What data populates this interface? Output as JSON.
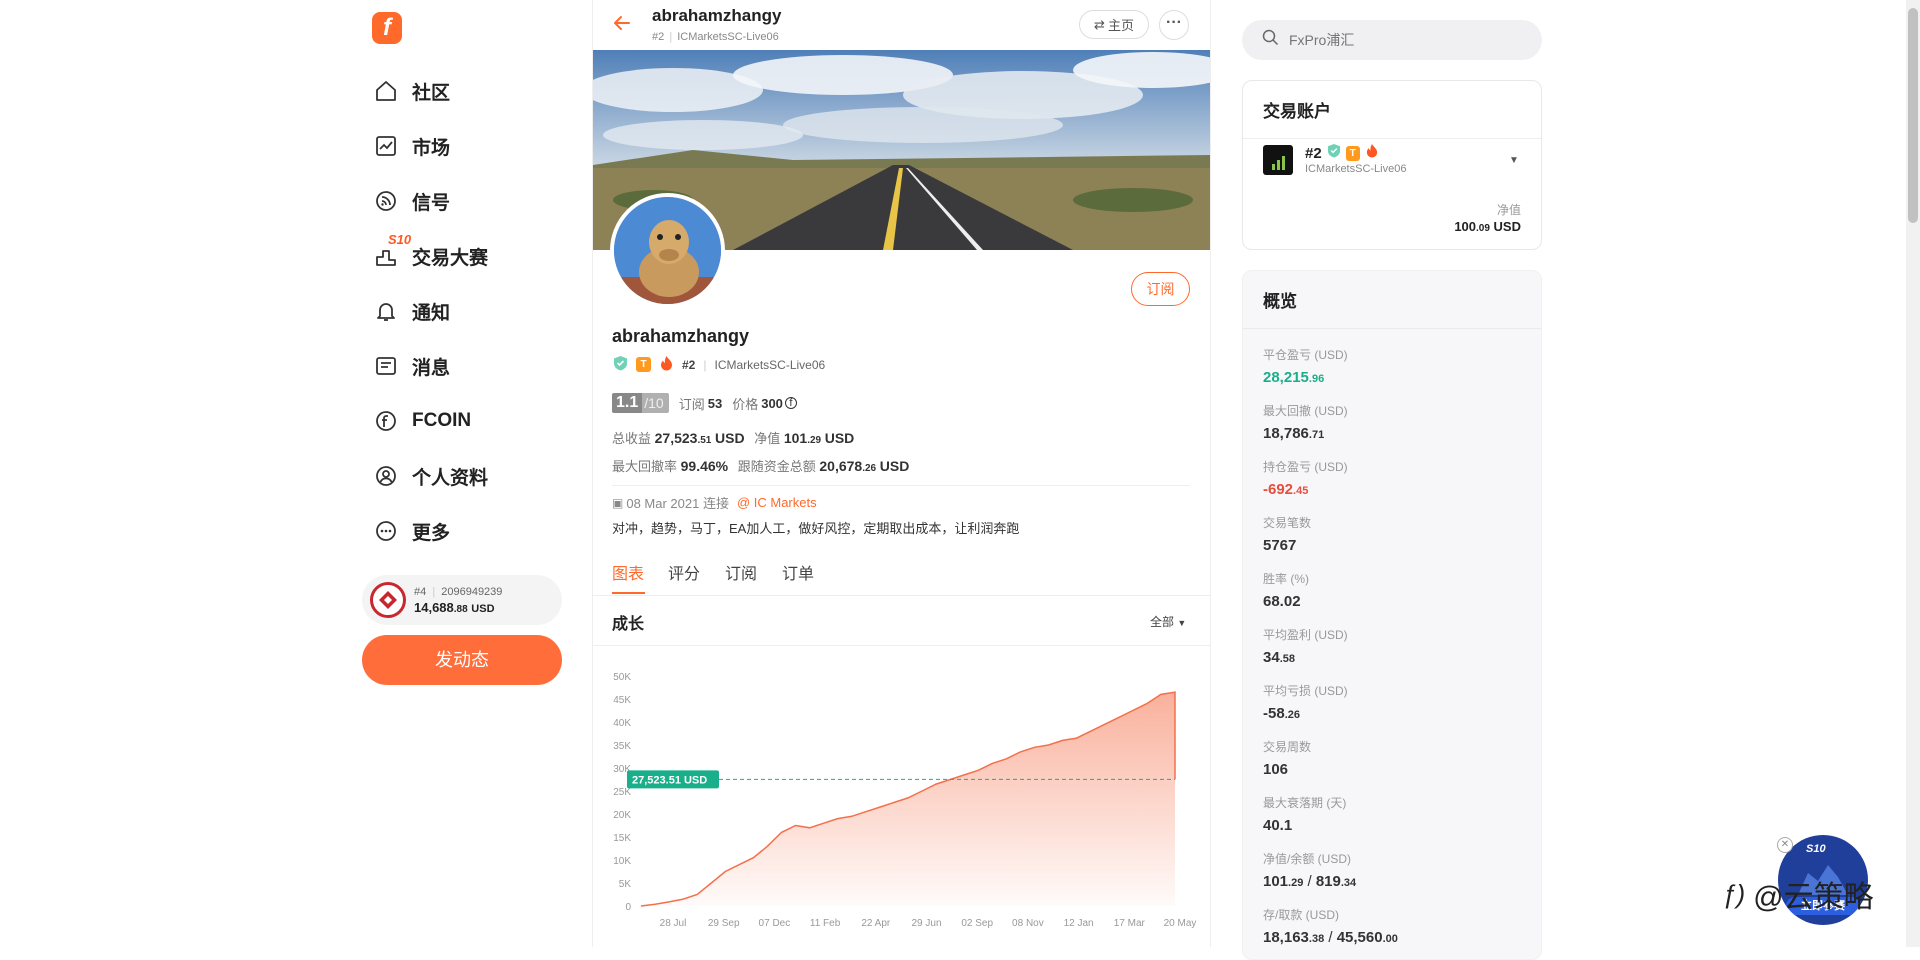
{
  "colors": {
    "accent": "#ff6a2b",
    "green": "#1aaf8b",
    "red": "#e84c3d",
    "chart_line": "#f4704a"
  },
  "sidebar": {
    "items": [
      {
        "label": "社区",
        "icon": "home-icon"
      },
      {
        "label": "市场",
        "icon": "chart-icon"
      },
      {
        "label": "信号",
        "icon": "rss-icon"
      },
      {
        "label": "交易大赛",
        "icon": "podium-icon",
        "badge": "S10"
      },
      {
        "label": "通知",
        "icon": "bell-icon"
      },
      {
        "label": "消息",
        "icon": "message-icon"
      },
      {
        "label": "FCOIN",
        "icon": "coin-icon"
      },
      {
        "label": "个人资料",
        "icon": "user-icon"
      },
      {
        "label": "更多",
        "icon": "more-icon"
      }
    ],
    "account": {
      "rank": "#4",
      "id": "2096949239",
      "balance_main": "14,688",
      "balance_dec": ".88",
      "currency": "USD"
    },
    "post_button": "发动态"
  },
  "header": {
    "name": "abrahamzhangy",
    "rank": "#2",
    "server": "ICMarketsSC-Live06",
    "home_button": "主页"
  },
  "profile": {
    "name": "abrahamzhangy",
    "rank": "#2",
    "server": "ICMarketsSC-Live06",
    "subscribe_button": "订阅",
    "score": "1.1",
    "score_max": "/10",
    "subs_label": "订阅",
    "subs_value": "53",
    "price_label": "价格",
    "price_value": "300",
    "total_label": "总收益",
    "total_main": "27,523",
    "total_dec": ".51",
    "total_unit": "USD",
    "equity_label": "净值",
    "equity_main": "101",
    "equity_dec": ".29",
    "equity_unit": "USD",
    "dd_label": "最大回撤率",
    "dd_value": "99.46%",
    "follow_label": "跟随资金总额",
    "follow_main": "20,678",
    "follow_dec": ".26",
    "follow_unit": "USD",
    "connected": "08 Mar 2021 连接",
    "broker": "IC Markets",
    "bio": "对冲，趋势，马丁，EA加人工，做好风控，定期取出成本，让利润奔跑"
  },
  "tabs": [
    "图表",
    "评分",
    "订阅",
    "订单"
  ],
  "growth": {
    "title": "成长",
    "filter": "全部",
    "current_label": "27,523.51 USD"
  },
  "chart_data": {
    "type": "area",
    "title": "成长",
    "x_ticks": [
      "28 Jul",
      "29 Sep",
      "07 Dec",
      "11 Feb",
      "22 Apr",
      "29 Jun",
      "02 Sep",
      "08 Nov",
      "12 Jan",
      "17 Mar",
      "20 May"
    ],
    "y_ticks": [
      "0",
      "5K",
      "10K",
      "15K",
      "20K",
      "25K",
      "30K",
      "35K",
      "40K",
      "45K",
      "50K"
    ],
    "ylim": [
      0,
      50000
    ],
    "reference_line": 27523.51,
    "series": [
      {
        "values": [
          0,
          400,
          900,
          1500,
          2500,
          5000,
          7500,
          9000,
          10500,
          13000,
          16000,
          17500,
          17000,
          18000,
          19000,
          19500,
          20500,
          21500,
          22500,
          23500,
          25000,
          26500,
          27500,
          28500,
          29500,
          31000,
          32000,
          33500,
          34500,
          35000,
          36000,
          36500,
          38000,
          39500,
          41000,
          42500,
          44000,
          46000,
          46500,
          27523
        ]
      }
    ]
  },
  "search": {
    "placeholder": "FxPro浦汇"
  },
  "trade_account": {
    "title": "交易账户",
    "rank": "#2",
    "server": "ICMarketsSC-Live06",
    "equity_label": "净值",
    "equity_main": "100",
    "equity_dec": ".09",
    "equity_unit": "USD"
  },
  "overview": {
    "title": "概览",
    "stats": [
      {
        "label": "平仓盈亏 (USD)",
        "main": "28,215",
        "dec": ".96",
        "color": "#1aaf8b"
      },
      {
        "label": "最大回撤 (USD)",
        "main": "18,786",
        "dec": ".71",
        "color": "#333333"
      },
      {
        "label": "持仓盈亏 (USD)",
        "main": "-692",
        "dec": ".45",
        "color": "#e84c3d"
      },
      {
        "label": "交易笔数",
        "main": "5767",
        "dec": "",
        "color": "#333333"
      },
      {
        "label": "胜率 (%)",
        "main": "68.02",
        "dec": "",
        "color": "#333333"
      },
      {
        "label": "平均盈利 (USD)",
        "main": "34",
        "dec": ".58",
        "color": "#333333"
      },
      {
        "label": "平均亏损 (USD)",
        "main": "-58",
        "dec": ".26",
        "color": "#333333"
      },
      {
        "label": "交易周数",
        "main": "106",
        "dec": "",
        "color": "#333333"
      },
      {
        "label": "最大衰落期 (天)",
        "main": "40.1",
        "dec": "",
        "color": "#333333"
      },
      {
        "label": "净值/余额 (USD)",
        "main": "101",
        "dec": ".29",
        "sep": " / ",
        "main2": "819",
        "dec2": ".34",
        "color": "#333333"
      },
      {
        "label": "存/取款 (USD)",
        "main": "18,163",
        "dec": ".38",
        "sep": " / ",
        "main2": "45,560",
        "dec2": ".00",
        "color": "#333333"
      }
    ]
  },
  "contest_float": {
    "badge": "S10",
    "button": "立即参赛"
  },
  "watermark": "@云策略"
}
